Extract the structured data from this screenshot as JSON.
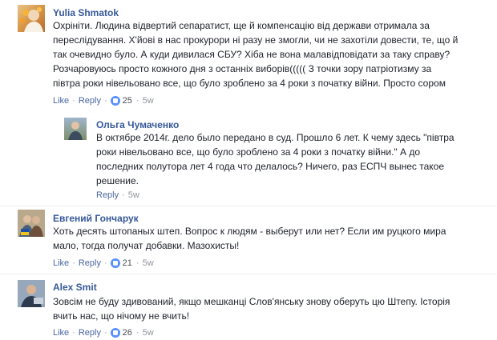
{
  "comments": [
    {
      "name": "Yulia Shmatok",
      "text": "Охрініти. Людина відвертий сепаратист, ще й компенсацію від держави отримала за\nпереслідування. Х'йові в нас прокурори ні разу не змогли, чи не захотіли довести, те, що й\nтак очевидно було. А куди дивилася СБУ? Хіба не вона малавідповідати за таку справу?\nРозчаровуюсь просто кожного дня з останніх виборів((((( З точки зору патріотизму за\nпівтра роки нівельовано все, що було зроблено за 4 роки з початку війни. Просто сором",
      "like": "Like",
      "reply": "Reply",
      "likes": "25",
      "time": "5w"
    },
    {
      "name": "Ольга Чумаченко",
      "text": "В октябре 2014г. дело было передано в суд. Прошло 6 лет. К чему здесь \"півтра\nроки нівельовано все, що було зроблено за 4 роки з початку війни.\" А до\nпоследних полутора лет 4 года что делалось? Ничего, раз ЕСПЧ вынес такое\nрешение.",
      "reply": "Reply",
      "time": "5w"
    },
    {
      "name": "Евгений Гончарук",
      "text": "Хоть десять штопаных штеп. Вопрос к людям - выберут или нет? Если им руцкого мира\nмало, тогда получат добавки. Мазохисты!",
      "like": "Like",
      "reply": "Reply",
      "likes": "21",
      "time": "5w"
    },
    {
      "name": "Alex Smit",
      "text": "Зовсім не буду здивований, якщо мешканці Слов'янську знову оберуть цю Штепу. Історія\nвчить нас, що нічому не вчить!",
      "like": "Like",
      "reply": "Reply",
      "likes": "26",
      "time": "5w"
    }
  ],
  "colors": {
    "name": "#365899",
    "link": "#4b67a1",
    "meta": "#90949c",
    "like_badge": "#5890ff"
  },
  "icons": [
    "chevron-down-icon",
    "like-reaction-icon"
  ]
}
